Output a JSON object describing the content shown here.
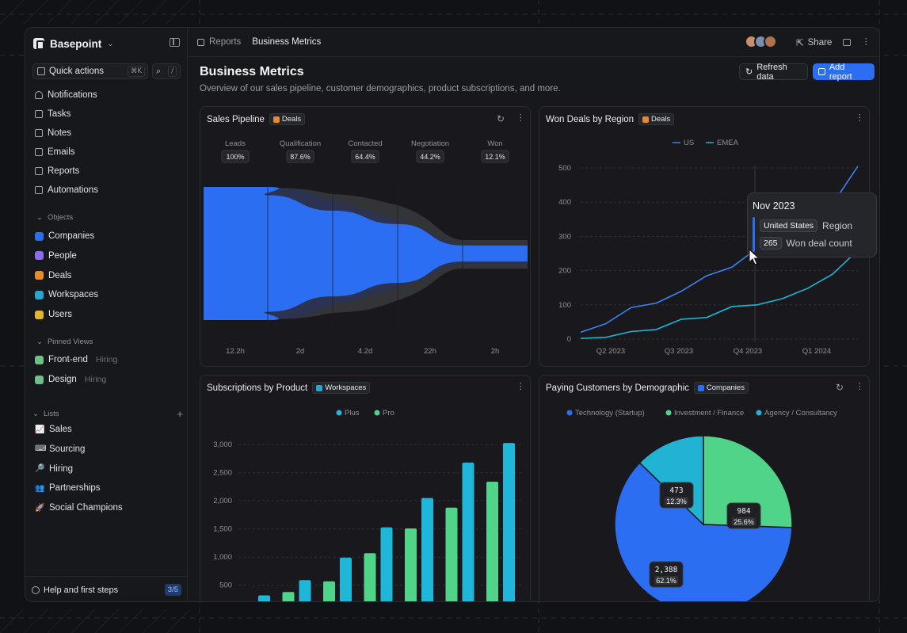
{
  "sidebar": {
    "workspace": "Basepoint",
    "quick_actions": "Quick actions",
    "quick_actions_kbd": "⌘K",
    "search_kbd": "/",
    "nav": [
      {
        "label": "Notifications",
        "icon": "bell-icon"
      },
      {
        "label": "Tasks",
        "icon": "checkbox-icon"
      },
      {
        "label": "Notes",
        "icon": "note-icon"
      },
      {
        "label": "Emails",
        "icon": "mail-icon"
      },
      {
        "label": "Reports",
        "icon": "reports-icon"
      },
      {
        "label": "Automations",
        "icon": "automation-icon"
      }
    ],
    "objects_title": "Objects",
    "objects": [
      {
        "label": "Companies",
        "color": "#2c6ef2"
      },
      {
        "label": "People",
        "color": "#8b6cf0"
      },
      {
        "label": "Deals",
        "color": "#e78a2c"
      },
      {
        "label": "Workspaces",
        "color": "#27a7cf"
      },
      {
        "label": "Users",
        "color": "#e2b434"
      }
    ],
    "pinned_title": "Pinned Views",
    "pinned": [
      {
        "label": "Front-end",
        "hint": "Hiring",
        "icon": "person-icon"
      },
      {
        "label": "Design",
        "hint": "Hiring",
        "icon": "person-icon"
      }
    ],
    "lists_title": "Lists",
    "lists": [
      {
        "label": "Sales",
        "emoji": "📈"
      },
      {
        "label": "Sourcing",
        "emoji": "⌨"
      },
      {
        "label": "Hiring",
        "emoji": "🔎"
      },
      {
        "label": "Partnerships",
        "emoji": "👥"
      },
      {
        "label": "Social Champions",
        "emoji": "🚀"
      }
    ],
    "help": "Help and first steps",
    "help_count": "3/5"
  },
  "topbar": {
    "crumb_parent": "Reports",
    "crumb_current": "Business Metrics",
    "share": "Share"
  },
  "page": {
    "title": "Business Metrics",
    "subtitle": "Overview of our sales pipeline, customer demographics, product subscriptions, and more.",
    "refresh": "Refresh data",
    "add": "Add report"
  },
  "cards": {
    "pipeline": {
      "title": "Sales Pipeline",
      "tag": "Deals",
      "tag_color": "#e78a2c"
    },
    "won": {
      "title": "Won Deals by Region",
      "tag": "Deals",
      "tag_color": "#e78a2c"
    },
    "subs": {
      "title": "Subscriptions by Product",
      "tag": "Workspaces",
      "tag_color": "#27a7cf"
    },
    "paying": {
      "title": "Paying Customers by Demographic",
      "tag": "Companies",
      "tag_color": "#2c6ef2"
    }
  },
  "tooltip": {
    "title": "Nov 2023",
    "region_value": "United States",
    "region_label": "Region",
    "count_value": "265",
    "count_label": "Won deal count"
  },
  "chart_data": [
    {
      "type": "area",
      "title": "Sales Pipeline",
      "categories": [
        "Leads",
        "Qualification",
        "Contacted",
        "Negotiation",
        "Won"
      ],
      "percent_labels": [
        "100%",
        "87.6%",
        "64.4%",
        "44.2%",
        "12.1%"
      ],
      "values": [
        100,
        87.6,
        64.4,
        44.2,
        12.1
      ],
      "durations": [
        "12.2h",
        "2d",
        "4.2d",
        "22h",
        "2h"
      ],
      "color": "#2c6ef2"
    },
    {
      "type": "line",
      "title": "Won Deals by Region",
      "x_ticks": [
        "Q2 2023",
        "Q3 2023",
        "Q4 2023",
        "Q1 2024"
      ],
      "y_ticks": [
        "0",
        "100",
        "200",
        "300",
        "400",
        "500"
      ],
      "ylim": [
        0,
        500
      ],
      "legend": "top",
      "series": [
        {
          "name": "US",
          "color": "#3b82f6",
          "values": [
            20,
            45,
            92,
            105,
            140,
            185,
            210,
            265,
            288,
            345,
            395,
            505
          ]
        },
        {
          "name": "EMEA",
          "color": "#22b3d4",
          "values": [
            2,
            5,
            22,
            28,
            58,
            63,
            95,
            100,
            118,
            148,
            190,
            260
          ]
        }
      ]
    },
    {
      "type": "bar",
      "title": "Subscriptions by Product",
      "y_ticks": [
        "500",
        "1,000",
        "1,500",
        "2,000",
        "2,500",
        "3,000"
      ],
      "ylim": [
        200,
        3200
      ],
      "legend": "top",
      "series": [
        {
          "name": "Plus",
          "color": "#1fb6d9",
          "values": [
            320,
            590,
            990,
            1530,
            2050,
            2680,
            3030
          ]
        },
        {
          "name": "Pro",
          "color": "#4fd48a",
          "values": [
            210,
            380,
            570,
            1070,
            1510,
            1880,
            2340
          ]
        }
      ]
    },
    {
      "type": "pie",
      "title": "Paying Customers by Demographic",
      "legend": "top",
      "slices": [
        {
          "name": "Technology (Startup)",
          "value": "2,388",
          "pct": "62.1%",
          "color": "#2c6ef2",
          "frac": 0.621
        },
        {
          "name": "Investment / Finance",
          "value": "984",
          "pct": "25.6%",
          "color": "#4fd48a",
          "frac": 0.256
        },
        {
          "name": "Agency / Consultancy",
          "value": "473",
          "pct": "12.3%",
          "color": "#22b3d4",
          "frac": 0.123
        }
      ]
    }
  ]
}
